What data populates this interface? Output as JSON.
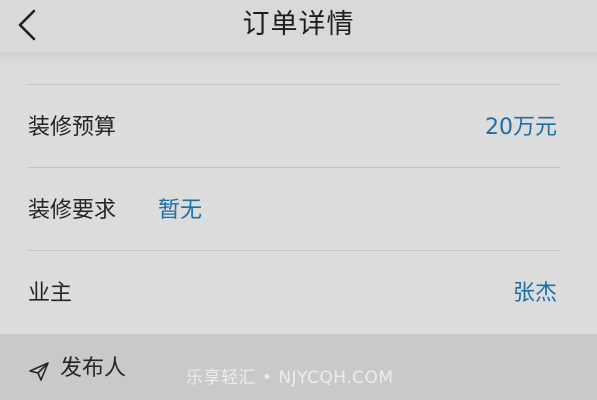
{
  "header": {
    "title": "订单详情",
    "back_icon": "chevron-left-icon"
  },
  "rows": [
    {
      "label": "装修预算",
      "value": "20万元",
      "value_align": "right"
    },
    {
      "label": "装修要求",
      "value": "暂无",
      "value_align": "inline"
    },
    {
      "label": "业主",
      "value": "张杰",
      "value_align": "right"
    }
  ],
  "footer": {
    "icon": "send-icon",
    "label": "发布人"
  },
  "watermark": "乐享轻汇 • NJYCQH.COM",
  "colors": {
    "value_text": "#1d6fa5",
    "background": "#dcdcdc",
    "footer_background": "#c9c9c9"
  }
}
